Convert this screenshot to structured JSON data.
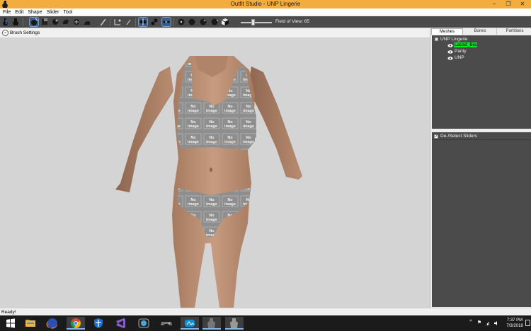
{
  "window": {
    "title": "Outfit Studio - UNP Lingerie",
    "controls": {
      "minimize": "–",
      "maximize": "❐",
      "close": "✕"
    }
  },
  "menu": [
    "File",
    "Edit",
    "Shape",
    "Slider",
    "Tool"
  ],
  "toolbar": {
    "tools": [
      "select-tool-icon",
      "transform-tool-icon",
      "brush-mask-icon",
      "brush-inflate-icon",
      "brush-deflate-icon",
      "brush-move-icon",
      "brush-smooth-icon",
      "brush-weight-icon",
      "brush-color-icon",
      "pen-icon",
      "brush-alpha-icon",
      "mirror-x-icon",
      "merge-icon",
      "connect-icon",
      "sphere-icon",
      "sphere-dark-icon",
      "sphere-lit-icon",
      "sphere-edge-icon",
      "cube-icon"
    ],
    "field_of_view_label": "Field of View: 65",
    "field_of_view": 65
  },
  "brush_settings": {
    "label": "Brush Settings"
  },
  "panel": {
    "tabs": [
      "Meshes",
      "Bones",
      "Partitions"
    ],
    "active_tab": "Meshes",
    "tree": {
      "root": "UNP Lingerie",
      "items": [
        {
          "name": "Laced_Bra",
          "selected": true
        },
        {
          "name": "Panty",
          "selected": false
        },
        {
          "name": "UNP",
          "selected": false
        }
      ]
    },
    "sliders_toggle_label": "De-/Select Sliders",
    "sliders_checked": true
  },
  "viewport": {
    "texture_text_line1": "No",
    "texture_text_line2": "image"
  },
  "status": {
    "text": "Ready!"
  },
  "taskbar": {
    "apps": [
      "windows-start-icon",
      "file-explorer-icon",
      "firefox-icon",
      "chrome-icon",
      "security-shield-icon",
      "visual-studio-icon",
      "camera-app-icon",
      "gamepad-icon",
      "photos-app-icon",
      "outfit-studio-icon",
      "outfit-studio-icon-2"
    ],
    "tray": [
      "tray-chevron-icon",
      "flag-icon",
      "wifi-icon",
      "volume-icon",
      "notifications-icon"
    ],
    "clock_time": "7:37 PM",
    "clock_date": "7/3/2018"
  },
  "colors": {
    "titlebar": "#f3ad3e",
    "toolbar": "#4b4b4b",
    "panel": "#4b4b4b",
    "selection": "#00e820",
    "viewport": "#d4d4d4",
    "taskbar": "#1b1b1b"
  }
}
